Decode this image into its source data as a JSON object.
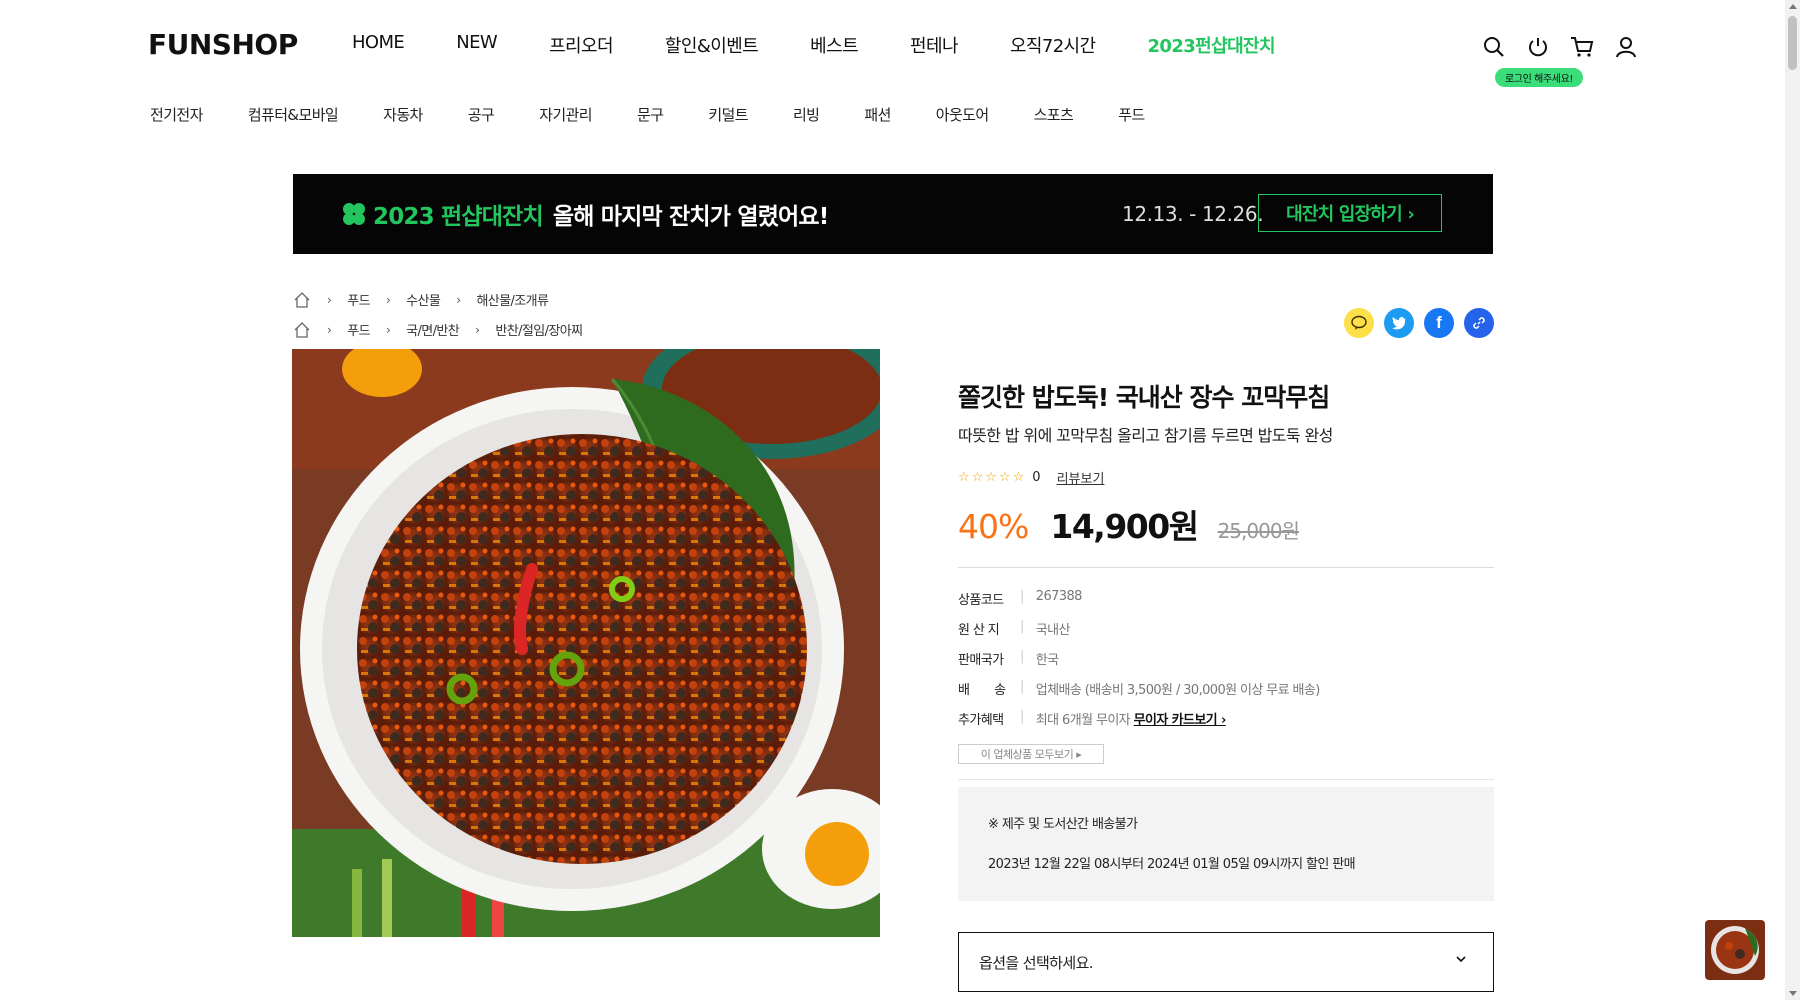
{
  "header": {
    "logo": "FUNSHOP",
    "nav": [
      "HOME",
      "NEW",
      "프리오더",
      "할인&이벤트",
      "베스트",
      "펀테나",
      "오직72시간",
      "2023펀샵대잔치"
    ],
    "login_badge": "로그인 해주세요!",
    "icons": [
      "search-icon",
      "power-icon",
      "cart-icon",
      "user-icon"
    ]
  },
  "categories": [
    "전기전자",
    "컴퓨터&모바일",
    "자동차",
    "공구",
    "자기관리",
    "문구",
    "키덜트",
    "리빙",
    "패션",
    "아웃도어",
    "스포츠",
    "푸드"
  ],
  "banner": {
    "title": "2023 펀샵대잔치",
    "text": "올해 마지막 잔치가 열렸어요!",
    "date": "12.13. - 12.26.",
    "button": "대잔치 입장하기 ›"
  },
  "breadcrumbs": [
    [
      "푸드",
      "수산물",
      "해산물/조개류"
    ],
    [
      "푸드",
      "국/면/반찬",
      "반찬/절임/장아찌"
    ]
  ],
  "product": {
    "title": "쫄깃한 밥도둑! 국내산 장수 꼬막무침",
    "subtitle": "따뜻한 밥 위에 꼬막무침 올리고 참기름 두르면 밥도둑 완성",
    "stars": "☆☆☆☆☆",
    "review_count": "0",
    "review_link": "리뷰보기",
    "discount": "40%",
    "price": "14,900원",
    "original_price": "25,000원",
    "specs": [
      {
        "k": "상품코드",
        "v": "267388"
      },
      {
        "k": "원 산 지",
        "v": "국내산"
      },
      {
        "k": "판매국가",
        "v": "한국"
      },
      {
        "k": "배　　송",
        "v": "업체배송 (배송비 3,500원 / 30,000원 이상 무료 배송)"
      },
      {
        "k": "추가혜택",
        "v": "최대 6개월 무이자",
        "link": "무이자 카드보기 ›"
      }
    ],
    "all_button": "이 업체상품 모두보기 ▸",
    "notice_1": "※ 제주 및 도서산간 배송불가",
    "notice_2": "2023년 12월 22일 08시부터 2024년 01월 05일 09시까지 할인 판매",
    "option_placeholder": "옵션을 선택하세요."
  },
  "colors": {
    "accent_green": "#22c55e",
    "discount_orange": "#f97316"
  }
}
